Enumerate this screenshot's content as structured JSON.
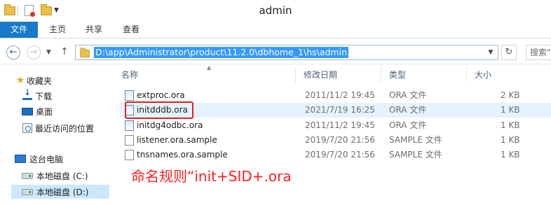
{
  "window": {
    "title": "admin"
  },
  "ribbon": {
    "tabs": [
      {
        "label": "文件"
      },
      {
        "label": "主页"
      },
      {
        "label": "共享"
      },
      {
        "label": "查看"
      }
    ]
  },
  "address": {
    "path": "D:\\app\\Administrator\\product\\11.2.0\\dbhome_1\\hs\\admin",
    "search_placeholder": "搜索\""
  },
  "nav": {
    "favorites": "收藏夹",
    "downloads": "下载",
    "desktop": "桌面",
    "recent": "最近访问的位置",
    "this_pc": "这台电脑",
    "drive_c": "本地磁盘 (C:)",
    "drive_d": "本地磁盘 (D:)"
  },
  "columns": {
    "name": "名称",
    "date": "修改日期",
    "type": "类型",
    "size": "大小"
  },
  "files": [
    {
      "name": "extproc.ora",
      "date": "2011/11/2 19:45",
      "type": "ORA 文件",
      "size": "2 KB",
      "icon": "ora-file-icon"
    },
    {
      "name": "initdddb.ora",
      "date": "2021/7/19 16:25",
      "type": "ORA 文件",
      "size": "1 KB",
      "icon": "ora-file-icon"
    },
    {
      "name": "initdg4odbc.ora",
      "date": "2011/11/2 19:45",
      "type": "ORA 文件",
      "size": "1 KB",
      "icon": "ora-file-icon"
    },
    {
      "name": "listener.ora.sample",
      "date": "2019/7/20 21:56",
      "type": "SAMPLE 文件",
      "size": "1 KB",
      "icon": "file-icon"
    },
    {
      "name": "tnsnames.ora.sample",
      "date": "2019/7/20 21:56",
      "type": "SAMPLE 文件",
      "size": "1 KB",
      "icon": "file-icon"
    }
  ],
  "annotation": {
    "text": "命名规则“init+SID+.ora",
    "color": "#ff2020"
  },
  "colors": {
    "file_tab": "#1979ca",
    "selection": "#3399ff",
    "highlight_box": "#e02020"
  }
}
